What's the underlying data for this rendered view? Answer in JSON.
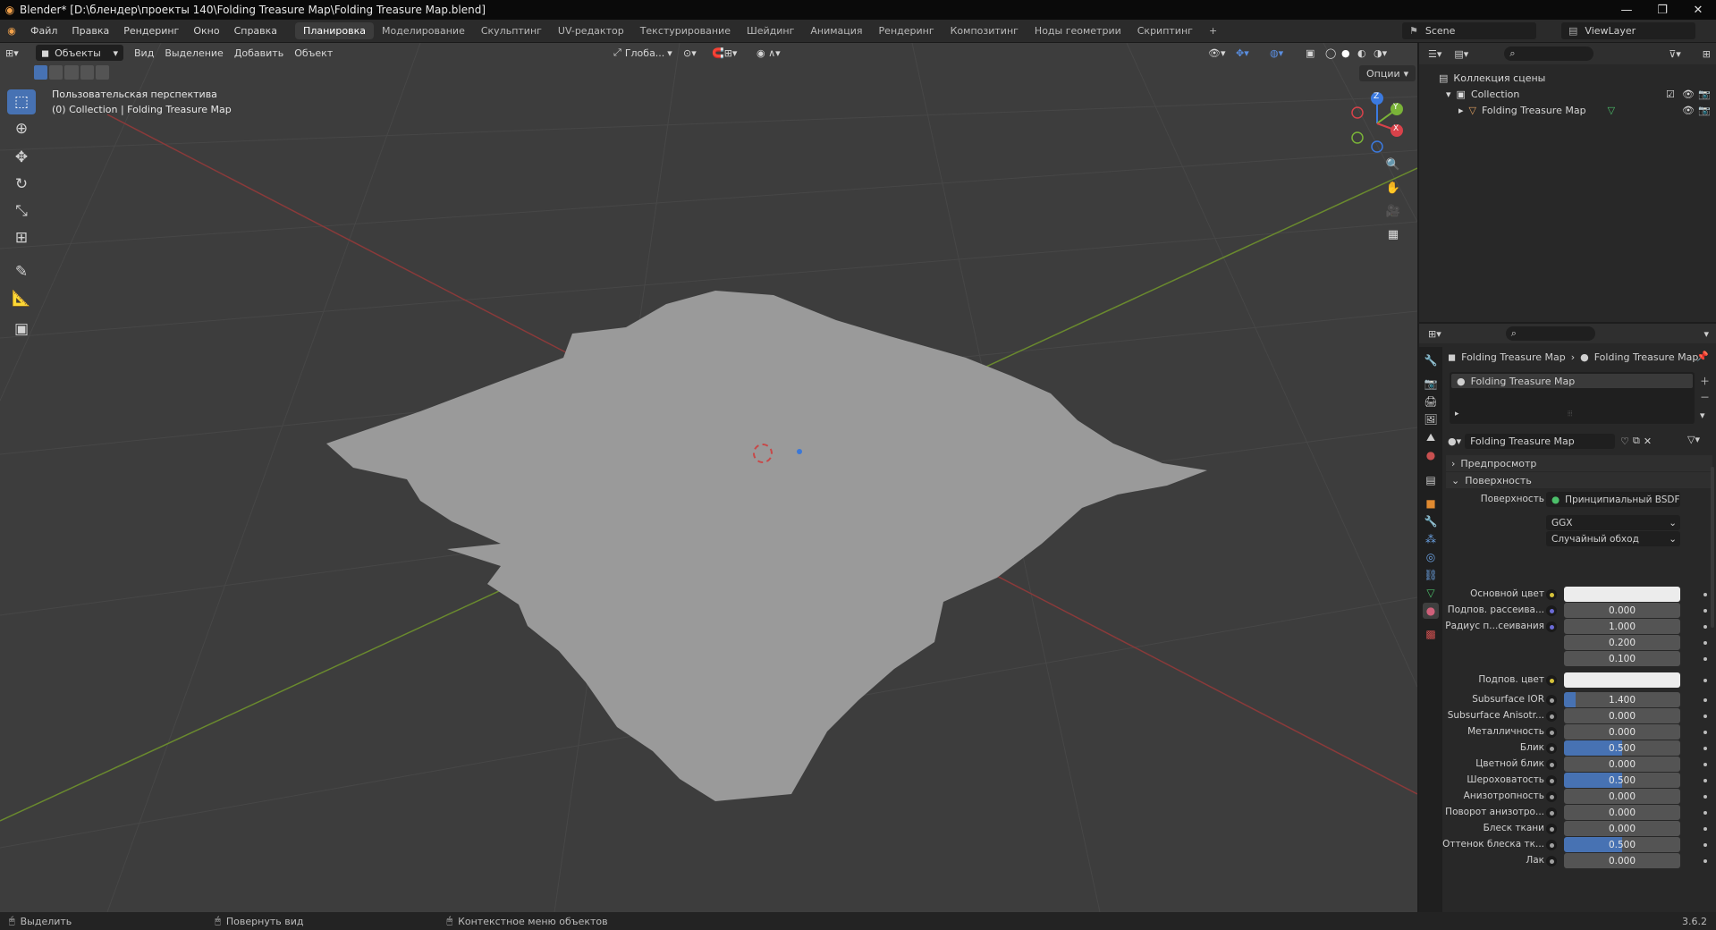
{
  "window": {
    "title": "Blender* [D:\\блендер\\проекты 140\\Folding Treasure Map\\Folding Treasure Map.blend]"
  },
  "menubar": {
    "items": [
      "Файл",
      "Правка",
      "Рендеринг",
      "Окно",
      "Справка"
    ]
  },
  "workspaces": {
    "tabs": [
      "Планировка",
      "Моделирование",
      "Скульптинг",
      "UV-редактор",
      "Текстурирование",
      "Шейдинг",
      "Анимация",
      "Рендеринг",
      "Композитинг",
      "Ноды геометрии",
      "Скриптинг"
    ],
    "active": "Планировка",
    "add": "+"
  },
  "scene": {
    "name": "Scene",
    "view_layer": "ViewLayer"
  },
  "viewport": {
    "mode": "Объекты",
    "menus": [
      "Вид",
      "Выделение",
      "Добавить",
      "Объект"
    ],
    "orientation": "Глоба...",
    "options": "Опции",
    "info_line1": "Пользовательская перспектива",
    "info_line2": "(0) Collection | Folding Treasure Map",
    "axis": {
      "x": "X",
      "y": "Y",
      "z": "Z"
    }
  },
  "outliner": {
    "root": "Коллекция сцены",
    "collection": "Collection",
    "object": "Folding Treasure Map"
  },
  "properties": {
    "breadcrumb_object": "Folding Treasure Map",
    "breadcrumb_material": "Folding Treasure Map",
    "slot": "Folding Treasure Map",
    "material_name": "Folding Treasure Map",
    "panel_preview": "Предпросмотр",
    "panel_surface": "Поверхность",
    "surface_label": "Поверхность",
    "surface_value": "Принципиальный BSDF",
    "distribution": "GGX",
    "subsurface_method": "Случайный обход",
    "rows": [
      {
        "label": "Основной цвет",
        "value": "",
        "kind": "color",
        "dot": "#d6c23a"
      },
      {
        "label": "Подпов. рассеива...",
        "value": "0.000",
        "kind": "num",
        "dot": "#6b6bd6"
      },
      {
        "label": "Радиус п...сеивания",
        "value": "1.000",
        "kind": "num",
        "dot": "#6b6bd6"
      },
      {
        "label": "",
        "value": "0.200",
        "kind": "num",
        "dot": ""
      },
      {
        "label": "",
        "value": "0.100",
        "kind": "num",
        "dot": ""
      },
      {
        "label": "Подпов. цвет",
        "value": "",
        "kind": "color",
        "dot": "#d6c23a"
      },
      {
        "label": "Subsurface IOR",
        "value": "1.400",
        "kind": "num",
        "dot": "#a0a0a0",
        "fill": 0.1
      },
      {
        "label": "Subsurface Anisotr...",
        "value": "0.000",
        "kind": "num",
        "dot": "#a0a0a0"
      },
      {
        "label": "Металличность",
        "value": "0.000",
        "kind": "num",
        "dot": "#a0a0a0"
      },
      {
        "label": "Блик",
        "value": "0.500",
        "kind": "num",
        "dot": "#a0a0a0",
        "fill": 0.5
      },
      {
        "label": "Цветной блик",
        "value": "0.000",
        "kind": "num",
        "dot": "#a0a0a0"
      },
      {
        "label": "Шероховатость",
        "value": "0.500",
        "kind": "num",
        "dot": "#a0a0a0",
        "fill": 0.5
      },
      {
        "label": "Анизотропность",
        "value": "0.000",
        "kind": "num",
        "dot": "#a0a0a0"
      },
      {
        "label": "Поворот анизотро...",
        "value": "0.000",
        "kind": "num",
        "dot": "#a0a0a0"
      },
      {
        "label": "Блеск ткани",
        "value": "0.000",
        "kind": "num",
        "dot": "#a0a0a0"
      },
      {
        "label": "Оттенок блеска тк...",
        "value": "0.500",
        "kind": "num",
        "dot": "#a0a0a0",
        "fill": 0.5
      },
      {
        "label": "Лак",
        "value": "0.000",
        "kind": "num",
        "dot": "#a0a0a0"
      }
    ]
  },
  "statusbar": {
    "select": "Выделить",
    "rotate": "Повернуть вид",
    "context": "Контекстное меню объектов",
    "version": "3.6.2"
  },
  "colors": {
    "accent": "#4772b3",
    "mesh": "#9a9a9a",
    "x_axis": "#b03838",
    "y_axis": "#7a9a2c"
  }
}
